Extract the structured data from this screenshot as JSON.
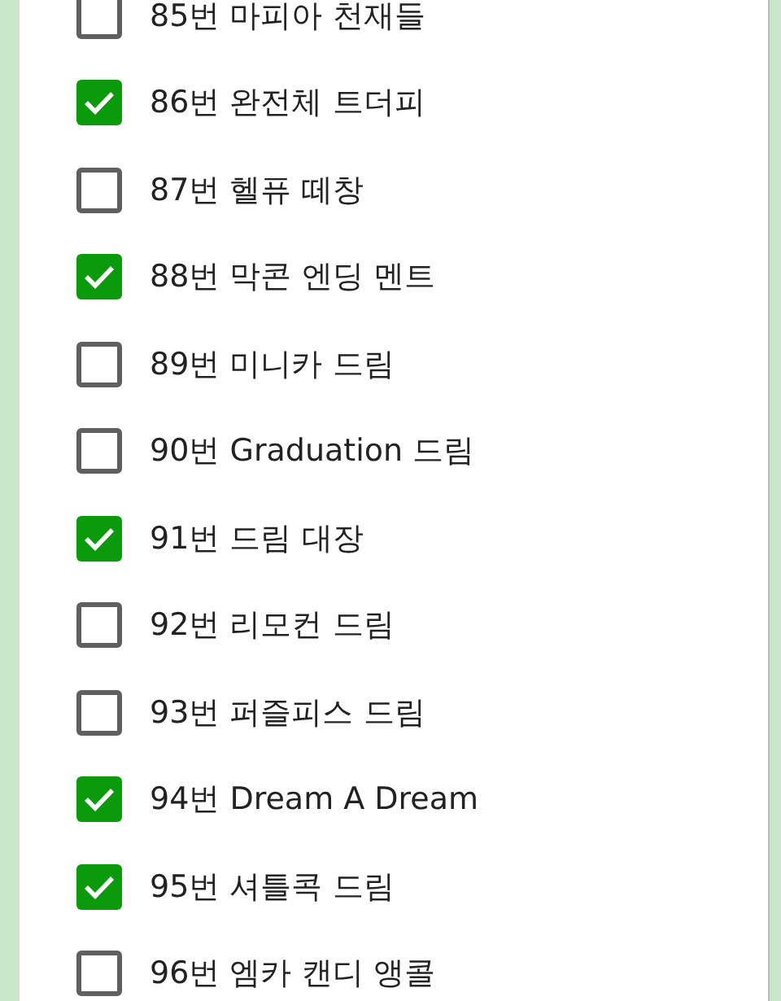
{
  "items": [
    {
      "label": "85번 마피아 천재들",
      "checked": false
    },
    {
      "label": "86번 완전체 트더피",
      "checked": true
    },
    {
      "label": "87번 헬퓨 떼창",
      "checked": false
    },
    {
      "label": "88번 막콘 엔딩 멘트",
      "checked": true
    },
    {
      "label": "89번 미니카 드림",
      "checked": false
    },
    {
      "label": "90번 Graduation 드림",
      "checked": false
    },
    {
      "label": "91번 드림 대장",
      "checked": true
    },
    {
      "label": "92번 리모컨 드림",
      "checked": false
    },
    {
      "label": "93번 퍼즐피스 드림",
      "checked": false
    },
    {
      "label": "94번 Dream A Dream",
      "checked": true
    },
    {
      "label": "95번 셔틀콕 드림",
      "checked": true
    },
    {
      "label": "96번 엠카 캔디 앵콜",
      "checked": false
    }
  ]
}
